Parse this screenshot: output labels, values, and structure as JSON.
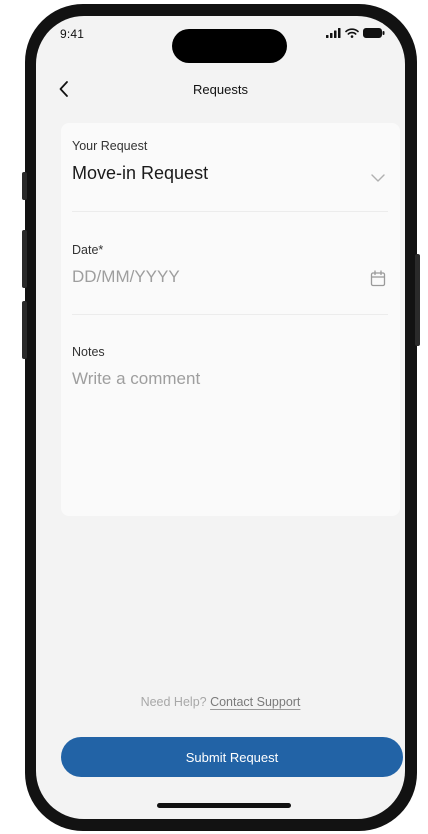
{
  "status_bar": {
    "time": "9:41"
  },
  "nav": {
    "title": "Requests"
  },
  "form": {
    "request": {
      "label": "Your Request",
      "value": "Move-in Request"
    },
    "date": {
      "label": "Date*",
      "placeholder": "DD/MM/YYYY"
    },
    "notes": {
      "label": "Notes",
      "placeholder": "Write a comment"
    }
  },
  "help": {
    "text": "Need Help?",
    "link": "Contact Support"
  },
  "submit_label": "Submit Request",
  "colors": {
    "primary": "#2263a6",
    "screen_bg": "#f3f3f3",
    "card_bg": "#fafafa",
    "frame": "#121212"
  },
  "icons": {
    "back": "chevron-left-icon",
    "dropdown": "chevron-down-icon",
    "date": "calendar-icon",
    "signal": "signal-icon",
    "wifi": "wifi-icon",
    "battery": "battery-icon"
  }
}
